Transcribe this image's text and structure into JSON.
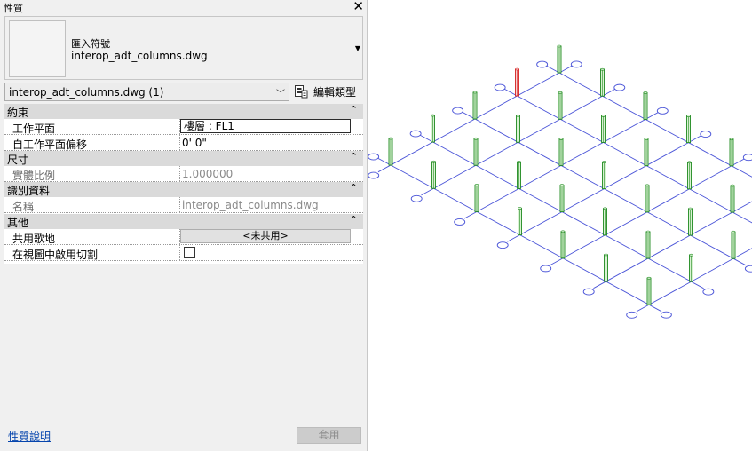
{
  "panel": {
    "title": "性質",
    "close_glyph": "✕"
  },
  "type_preview": {
    "family": "匯入符號",
    "type": "interop_adt_columns.dwg",
    "dropdown_glyph": "▼"
  },
  "selector": {
    "label": "interop_adt_columns.dwg (1)",
    "chevron": "﹀"
  },
  "edit_type": {
    "label": "編輯類型",
    "icon": "edit-type-icon"
  },
  "groups": {
    "constraints": {
      "label": "約束",
      "toggle": "⌃"
    },
    "dimensions": {
      "label": "尺寸",
      "toggle": "⌃"
    },
    "identity": {
      "label": "識別資料",
      "toggle": "⌃"
    },
    "other": {
      "label": "其他",
      "toggle": "⌃"
    }
  },
  "props": {
    "work_plane": {
      "label": "工作平面",
      "value": "樓層 : FL1"
    },
    "offset": {
      "label": "自工作平面偏移",
      "value": "0'  0\""
    },
    "scale": {
      "label": "實體比例",
      "value": "1.000000"
    },
    "name": {
      "label": "名稱",
      "value": "interop_adt_columns.dwg"
    },
    "shared_site": {
      "label": "共用歌地",
      "value": "<未共用>"
    },
    "crop": {
      "label": "在視圖中啟用切割",
      "checked": false
    }
  },
  "footer": {
    "help": "性質說明",
    "apply": "套用"
  },
  "viewport": {
    "grid_color": "#4b55d8",
    "column_color": "#1f8a1f",
    "column_fill": "#d9f2d3",
    "selected_color": "#d62020",
    "bubble_color": "#4b55d8"
  }
}
